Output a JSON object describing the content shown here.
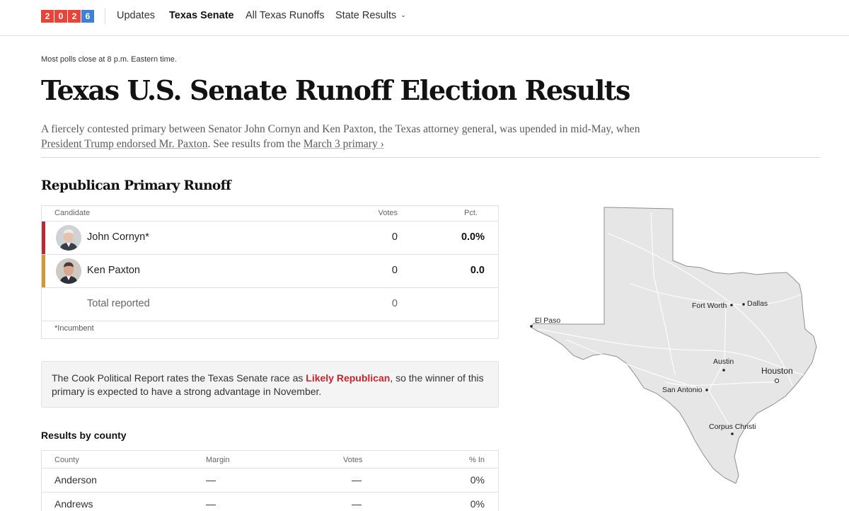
{
  "nav": {
    "logo_digits": [
      "2",
      "0",
      "2",
      "6"
    ],
    "items": [
      "Updates",
      "Texas Senate",
      "All Texas Runoffs",
      "State Results"
    ]
  },
  "notice": "Most polls close at 8 p.m. Eastern time.",
  "title": "Texas U.S. Senate Runoff Election Results",
  "dek": {
    "text1": "A fiercely contested primary between Senator John Cornyn and Ken Paxton, the Texas attorney general, was upended in mid-May, when ",
    "link1": "President Trump endorsed Mr. Paxton",
    "text2": ". See results from the ",
    "link2": "March 3 primary ›"
  },
  "race": {
    "title": "Republican Primary Runoff",
    "headers": {
      "candidate": "Candidate",
      "votes": "Votes",
      "pct": "Pct."
    },
    "candidates": [
      {
        "name": "John Cornyn*",
        "votes": "0",
        "pct": "0.0%",
        "color": "#b72b36"
      },
      {
        "name": "Ken Paxton",
        "votes": "0",
        "pct": "0.0",
        "color": "#d09933"
      }
    ],
    "total_label": "Total reported",
    "total_votes": "0",
    "footnote": "*Incumbent"
  },
  "cook": {
    "before": "The Cook Political Report rates the Texas Senate race as ",
    "rating": "Likely Republican",
    "after": ", so the winner of this primary is expected to have a strong advantage in November."
  },
  "county": {
    "title": "Results by county",
    "headers": {
      "county": "County",
      "margin": "Margin",
      "votes": "Votes",
      "pct_in": "% In"
    },
    "rows": [
      {
        "county": "Anderson",
        "margin": "—",
        "votes": "—",
        "pct_in": "0%"
      },
      {
        "county": "Andrews",
        "margin": "—",
        "votes": "—",
        "pct_in": "0%"
      }
    ]
  },
  "map": {
    "cities": [
      "El Paso",
      "Fort Worth",
      "Dallas",
      "Austin",
      "Houston",
      "San Antonio",
      "Corpus Christi"
    ]
  }
}
